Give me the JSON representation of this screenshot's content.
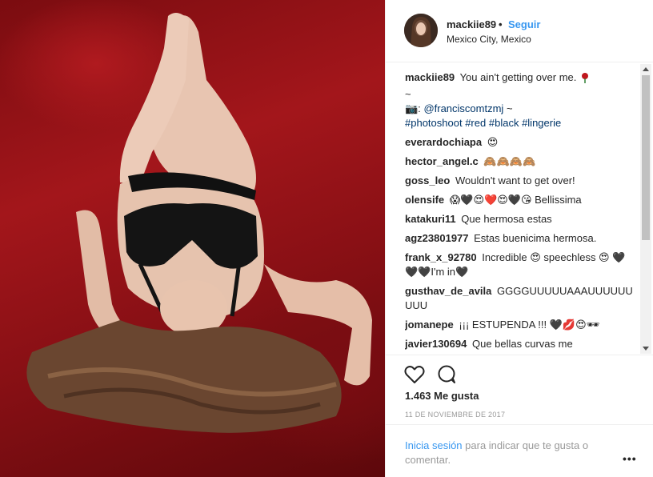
{
  "post": {
    "username": "mackiie89",
    "separator": "•",
    "follow_label": "Seguir",
    "location": "Mexico City, Mexico"
  },
  "caption": {
    "user": "mackiie89",
    "text": "You ain't getting over me.",
    "line2": "~",
    "camera_prefix": "📷:",
    "mention": "@franciscomtzmj",
    "line3_suffix": "~",
    "hashtags": [
      "#photoshoot",
      "#red",
      "#black",
      "#lingerie"
    ]
  },
  "comments": [
    {
      "user": "everardochiapa",
      "text": "😍"
    },
    {
      "user": "hector_angel.c",
      "text": "🙈🙈🙈🙈"
    },
    {
      "user": "goss_leo",
      "text": "Wouldn't want to get over!"
    },
    {
      "user": "olensife",
      "text": "😱🖤😍❤️😍🖤😘 Bellissima"
    },
    {
      "user": "katakuri11",
      "text": "Que hermosa estas"
    },
    {
      "user": "agz23801977",
      "text": "Estas buenicima hermosa."
    },
    {
      "user": "frank_x_92780",
      "text": "Incredible 😍 speechless 😍 🖤🖤🖤I'm in🖤"
    },
    {
      "user": "gusthav_de_avila",
      "text": "GGGGUUUUUAAAUUUUUUUUU"
    },
    {
      "user": "jomanepe",
      "text": "¡¡¡ ESTUPENDA !!! 🖤💋😍🕶"
    },
    {
      "user": "javier130694",
      "text": "Que bellas curvas me"
    }
  ],
  "icons": {
    "heart": "heart-outline-icon",
    "comment": "comment-bubble-icon",
    "more": "more-options-icon"
  },
  "likes": "1.463 Me gusta",
  "date": "11 DE NOVIEMBRE DE 2017",
  "login": {
    "link": "Inicia sesión",
    "text": " para indicar que te gusta o comentar."
  },
  "more_label": "•••",
  "colors": {
    "link_blue": "#3897f0",
    "text": "#262626",
    "muted": "#999999",
    "photo_red": "#9e1419"
  }
}
